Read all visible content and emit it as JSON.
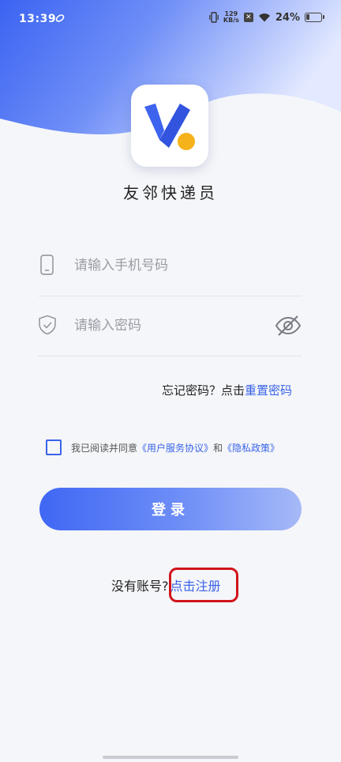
{
  "status_bar": {
    "time": "13:39",
    "net_speed_value": "129",
    "net_speed_unit": "KB/s",
    "battery_text": "24%",
    "battery_level": 0.24
  },
  "app": {
    "name": "友邻快递员",
    "logo_icon": "yl-courier-logo-icon"
  },
  "form": {
    "phone_placeholder": "请输入手机号码",
    "password_placeholder": "请输入密码",
    "forgot_prefix": "忘记密码？点击",
    "forgot_link": "重置密码"
  },
  "agreement": {
    "checked": false,
    "prefix": "我已阅读并同意",
    "user_agreement": "《用户服务协议》",
    "conjunction": "和",
    "privacy_policy": "《隐私政策》"
  },
  "login_label": "登录",
  "register": {
    "prefix": "没有账号?",
    "link": "点击注册"
  },
  "colors": {
    "accent": "#3a63e8",
    "highlight": "#d0141b",
    "logo_yellow": "#f6b21a"
  }
}
